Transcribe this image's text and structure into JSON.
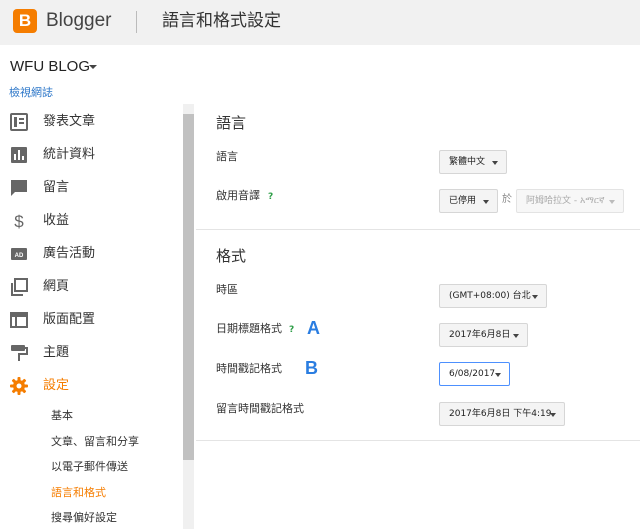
{
  "header": {
    "logo_letter": "B",
    "app_name": "Blogger",
    "page_title": "語言和格式設定"
  },
  "blog": {
    "name": "WFU BLOG",
    "view_link": "檢視網誌"
  },
  "sidebar": {
    "items": [
      {
        "label": "發表文章",
        "icon": "posts-icon"
      },
      {
        "label": "統計資料",
        "icon": "stats-icon"
      },
      {
        "label": "留言",
        "icon": "comments-icon"
      },
      {
        "label": "收益",
        "icon": "earnings-icon"
      },
      {
        "label": "廣告活動",
        "icon": "campaigns-icon"
      },
      {
        "label": "網頁",
        "icon": "pages-icon"
      },
      {
        "label": "版面配置",
        "icon": "layout-icon"
      },
      {
        "label": "主題",
        "icon": "theme-icon"
      },
      {
        "label": "設定",
        "icon": "gear-icon"
      }
    ],
    "sub_items": [
      "基本",
      "文章、留言和分享",
      "以電子郵件傳送",
      "語言和格式",
      "搜尋偏好設定"
    ],
    "active_color": "#f57d00"
  },
  "language_section": {
    "title": "語言",
    "language_label": "語言",
    "language_value": "繁體中文",
    "transliteration_label": "啟用音譯",
    "transliteration_help": "?",
    "transliteration_value": "已停用",
    "transliteration_joiner": "於",
    "transliteration_target": "阿姆哈拉文 - አማርኛ"
  },
  "format_section": {
    "title": "格式",
    "timezone_label": "時區",
    "timezone_value": "(GMT+08:00) 台北",
    "date_header_label": "日期標題格式",
    "date_header_help": "?",
    "date_header_value": "2017年6月8日",
    "marker_a": "A",
    "timestamp_label": "時間戳記格式",
    "timestamp_value": "6/08/2017",
    "marker_b": "B",
    "comment_timestamp_label": "留言時間戳記格式",
    "comment_timestamp_value": "2017年6月8日 下午4:19"
  },
  "colors": {
    "brand": "#f57d00",
    "link": "#2a75c8",
    "help": "#2e9e47",
    "marker": "#2a7de1"
  }
}
